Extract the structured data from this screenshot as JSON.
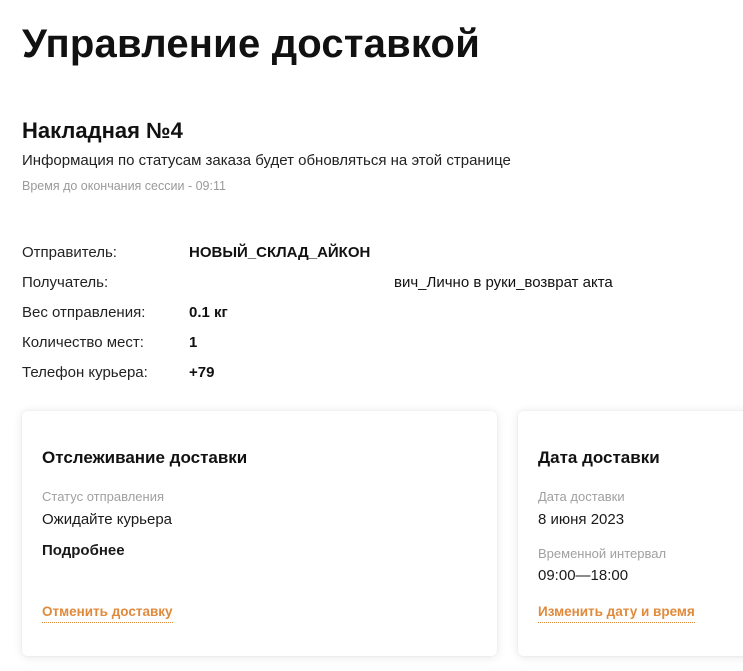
{
  "page": {
    "title": "Управление доставкой"
  },
  "invoice": {
    "title": "Накладная №4",
    "info": "Информация по статусам заказа будет обновляться на этой странице",
    "session": "Время до окончания сессии - 09:11"
  },
  "details": {
    "sender_label": "Отправитель:",
    "sender_value": "НОВЫЙ_СКЛАД_АЙКОН",
    "recipient_label": "Получатель:",
    "recipient_value": "вич_Лично в руки_возврат акта",
    "weight_label": "Вес отправления:",
    "weight_value": "0.1 кг",
    "places_label": "Количество мест:",
    "places_value": "1",
    "phone_label": "Телефон курьера:",
    "phone_value": "+79"
  },
  "tracking": {
    "title": "Отслеживание доставки",
    "status_label": "Статус отправления",
    "status_value": "Ожидайте курьера",
    "more_link": "Подробнее",
    "cancel_link": "Отменить доставку"
  },
  "delivery_date": {
    "title": "Дата доставки",
    "date_label": "Дата доставки",
    "date_value": "8 июня 2023",
    "interval_label": "Временной интервал",
    "interval_value": "09:00—18:00",
    "change_link": "Изменить дату и время"
  },
  "colors": {
    "accent": "#e08a3c",
    "muted": "#a0a0a0"
  }
}
